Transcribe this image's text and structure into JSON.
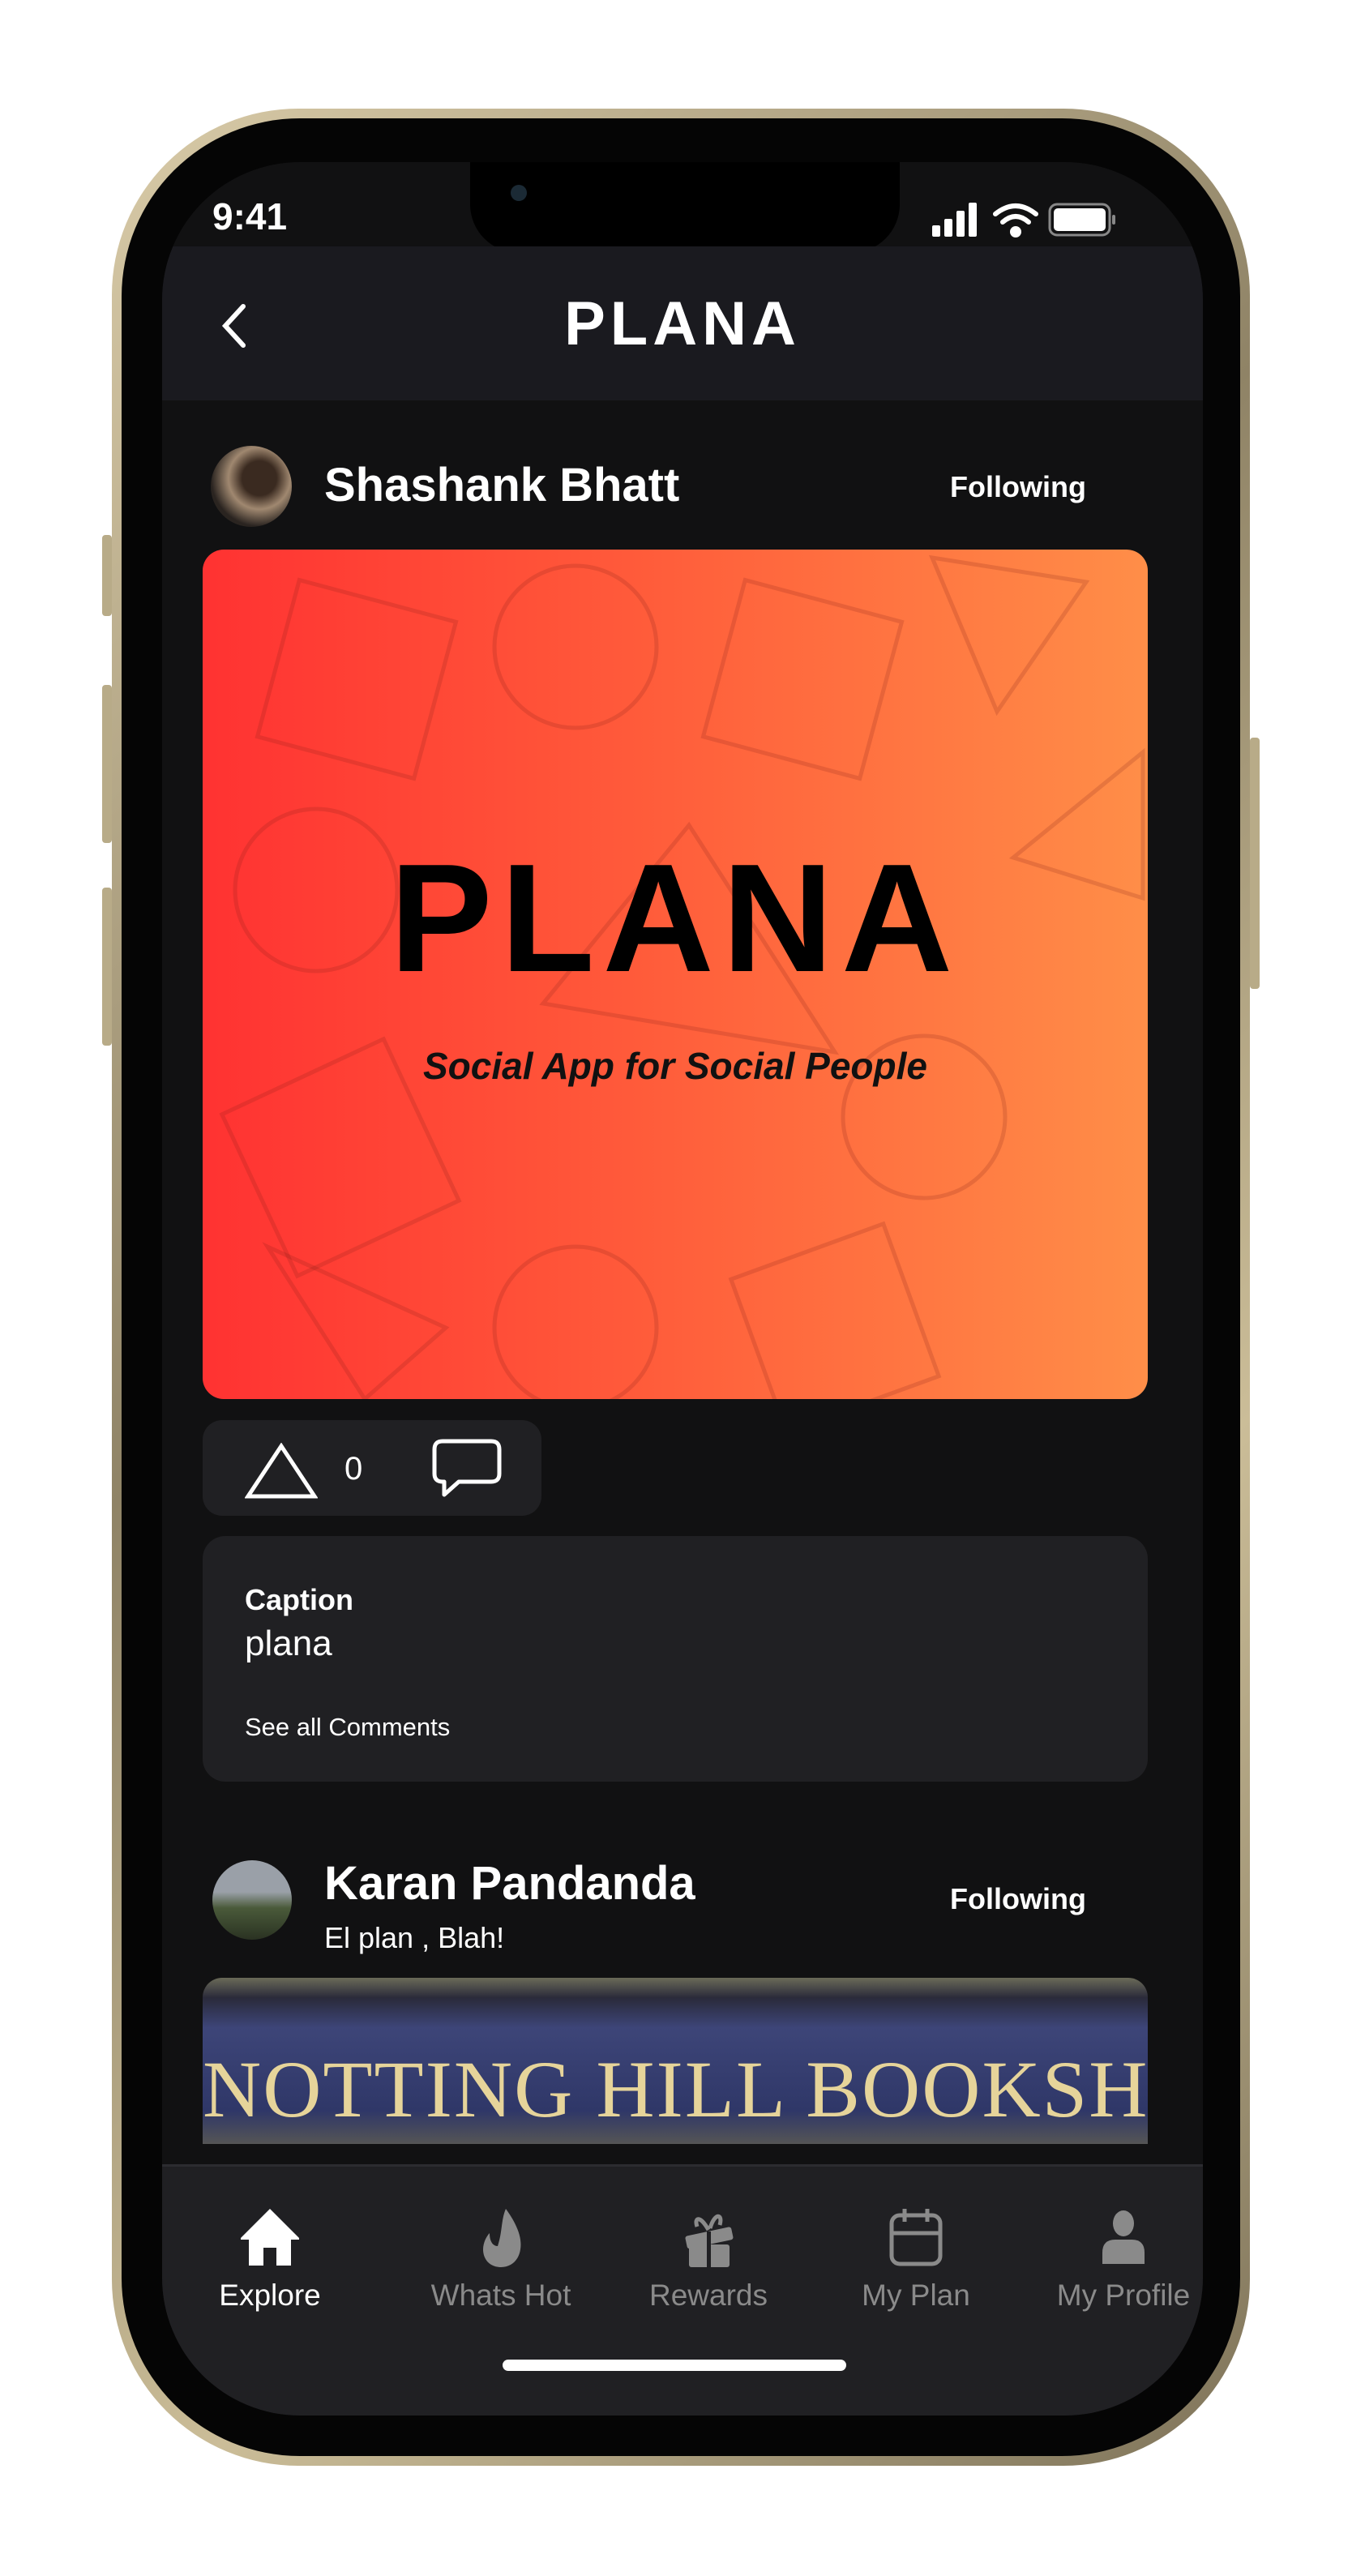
{
  "status_bar": {
    "time": "9:41"
  },
  "header": {
    "logo": "PLANA",
    "back_icon": "chevron-left-icon"
  },
  "posts": [
    {
      "author": "Shashank Bhatt",
      "follow_label": "Following",
      "image": {
        "logo": "PLANA",
        "tagline": "Social App for Social People"
      },
      "likes": "0",
      "caption_label": "Caption",
      "caption": "plana",
      "see_comments": "See all Comments"
    },
    {
      "author": "Karan Pandanda",
      "subtitle": "El plan , Blah!",
      "follow_label": "Following",
      "image_text": "NOTTING HILL BOOKSHOP"
    }
  ],
  "tabs": [
    {
      "label": "Explore",
      "icon": "home-icon",
      "active": true
    },
    {
      "label": "Whats Hot",
      "icon": "flame-icon"
    },
    {
      "label": "Rewards",
      "icon": "gift-icon"
    },
    {
      "label": "My Plan",
      "icon": "calendar-icon"
    },
    {
      "label": "My Profile",
      "icon": "person-icon"
    }
  ],
  "colors": {
    "gradient_start": "#ff3232",
    "gradient_end": "#ff8e48",
    "background": "#111112",
    "card": "#202023"
  }
}
